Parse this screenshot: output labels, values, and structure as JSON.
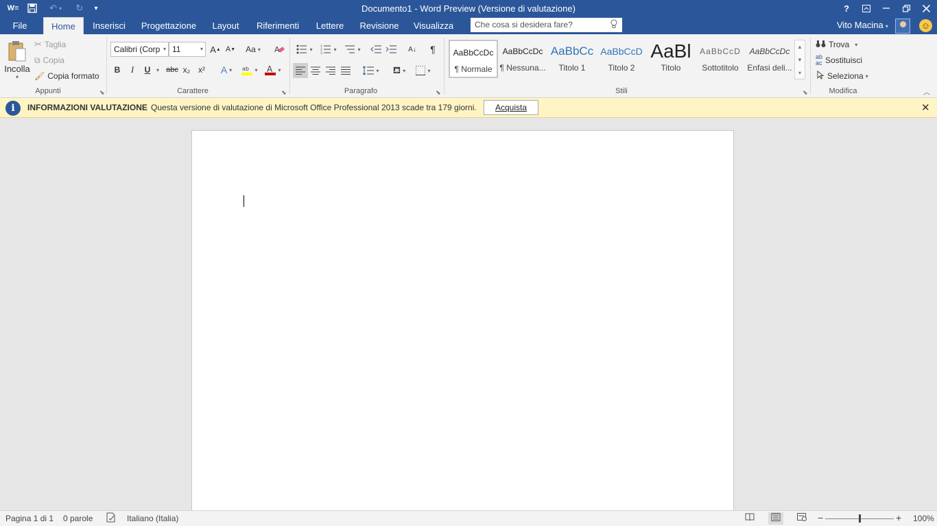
{
  "window": {
    "title": "Documento1 - Word Preview (Versione di valutazione)",
    "help": "?",
    "user_name": "Vito Macina"
  },
  "tabs": [
    {
      "label": "File"
    },
    {
      "label": "Home"
    },
    {
      "label": "Inserisci"
    },
    {
      "label": "Progettazione"
    },
    {
      "label": "Layout"
    },
    {
      "label": "Riferimenti"
    },
    {
      "label": "Lettere"
    },
    {
      "label": "Revisione"
    },
    {
      "label": "Visualizza"
    }
  ],
  "search": {
    "placeholder": "Che cosa si desidera fare?"
  },
  "clipboard": {
    "paste": "Incolla",
    "cut": "Taglia",
    "copy": "Copia",
    "format_painter": "Copia formato",
    "label": "Appunti"
  },
  "font": {
    "family": "Calibri (Corp",
    "size": "11",
    "case_button": "Aa",
    "bold": "B",
    "italic": "I",
    "underline": "U",
    "strike": "abc",
    "subscript": "x₂",
    "superscript": "x²",
    "label": "Carattere",
    "highlight_color": "#ffff00",
    "font_color": "#c00000"
  },
  "paragraph": {
    "label": "Paragrafo"
  },
  "styles": {
    "label": "Stili",
    "items": [
      {
        "preview": "AaBbCcDc",
        "name": "¶ Normale"
      },
      {
        "preview": "AaBbCcDc",
        "name": "¶ Nessuna..."
      },
      {
        "preview": "AaBbCc",
        "name": "Titolo 1"
      },
      {
        "preview": "AaBbCcD",
        "name": "Titolo 2"
      },
      {
        "preview": "AaBl",
        "name": "Titolo"
      },
      {
        "preview": "AaBbCcD",
        "name": "Sottotitolo"
      },
      {
        "preview": "AaBbCcDc",
        "name": "Enfasi deli..."
      }
    ]
  },
  "editing": {
    "find": "Trova",
    "replace": "Sostituisci",
    "select": "Seleziona",
    "label": "Modifica"
  },
  "infobar": {
    "title": "INFORMAZIONI VALUTAZIONE",
    "message": "Questa versione di valutazione di Microsoft Office Professional 2013 scade tra 179 giorni.",
    "button": "Acquista"
  },
  "status": {
    "page": "Pagina 1 di 1",
    "words": "0 parole",
    "language": "Italiano (Italia)",
    "zoom": "100%",
    "zoom_level": 1.0
  },
  "colors": {
    "brand": "#2b579a",
    "ribbon": "#f3f3f3",
    "infobar": "#fff4c4"
  }
}
